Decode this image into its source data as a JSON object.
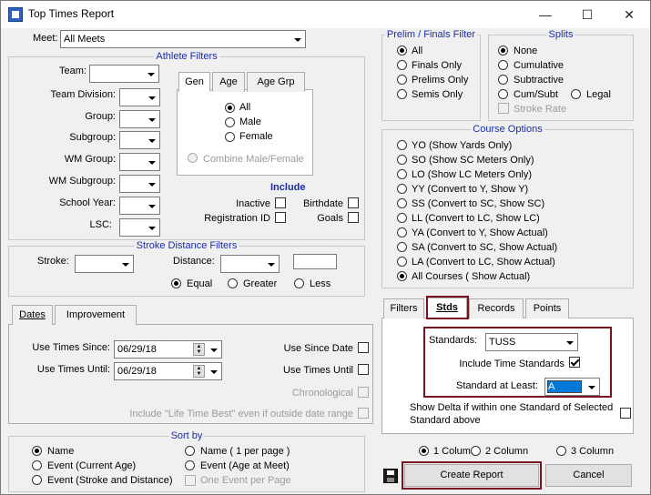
{
  "window": {
    "title": "Top Times Report"
  },
  "meet": {
    "label": "Meet:",
    "value": "All Meets"
  },
  "athlete_filters": {
    "title": "Athlete Filters",
    "fields": [
      "Team:",
      "Team Division:",
      "Group:",
      "Subgroup:",
      "WM Group:",
      "WM Subgroup:",
      "School Year:",
      "LSC:"
    ],
    "tabs": [
      "Gen",
      "Age",
      "Age Grp"
    ],
    "gender": [
      "All",
      "Male",
      "Female"
    ],
    "combine": "Combine Male/Female",
    "include_title": "Include",
    "include": {
      "inactive": "Inactive",
      "birthdate": "Birthdate",
      "registration": "Registration ID",
      "goals": "Goals"
    }
  },
  "stroke_distance": {
    "title": "Stroke Distance Filters",
    "stroke": "Stroke:",
    "distance": "Distance:",
    "options": [
      "Equal",
      "Greater",
      "Less"
    ]
  },
  "dates": {
    "tabs": [
      "Dates",
      "Improvement"
    ],
    "since_label": "Use Times Since:",
    "since_value": "06/29/18",
    "until_label": "Use Times Until:",
    "until_value": "06/29/18",
    "use_since_date": "Use Since Date",
    "use_times_until": "Use Times Until",
    "chronological": "Chronological",
    "life_time_best": "Include \"Life Time Best\" even if outside date range"
  },
  "sort_by": {
    "title": "Sort by",
    "name": "Name",
    "event_current_age": "Event (Current Age)",
    "event_stroke_distance": "Event (Stroke and Distance)",
    "name_per_page": "Name ( 1 per page )",
    "event_age_at_meet": "Event  (Age at Meet)",
    "one_event_per_page": "One Event per Page"
  },
  "prelim_finals": {
    "title": "Prelim / Finals Filter",
    "options": [
      "All",
      "Finals Only",
      "Prelims Only",
      "Semis Only"
    ]
  },
  "splits": {
    "title": "Splits",
    "options": [
      "None",
      "Cumulative",
      "Subtractive",
      "Cum/Subt"
    ],
    "legal": "Legal",
    "stroke_rate": "Stroke Rate"
  },
  "course_options": {
    "title": "Course Options",
    "options": [
      "YO (Show Yards Only)",
      "SO (Show SC Meters Only)",
      "LO (Show LC Meters Only)",
      "YY (Convert to Y, Show Y)",
      "SS (Convert to SC, Show SC)",
      "LL (Convert to LC, Show LC)",
      "YA (Convert to Y, Show Actual)",
      "SA (Convert to SC, Show Actual)",
      "LA (Convert to LC, Show Actual)",
      "All Courses ( Show Actual)"
    ]
  },
  "stds_panel": {
    "tabs": [
      "Filters",
      "Stds",
      "Records",
      "Points"
    ],
    "standards_label": "Standards:",
    "standards_value": "TUSS",
    "include_time_standards": "Include Time Standards",
    "standard_at_least_label": "Standard at Least:",
    "standard_at_least_value": "A",
    "show_delta": "Show Delta if within one Standard of Selected Standard above"
  },
  "columns": {
    "options": [
      "1 Column",
      "2 Column",
      "3 Column"
    ]
  },
  "buttons": {
    "create": "Create Report",
    "cancel": "Cancel"
  },
  "colors": {
    "accent_highlight": "#7b1020",
    "group_title": "#1a2ca8",
    "selection": "#0078d7"
  }
}
